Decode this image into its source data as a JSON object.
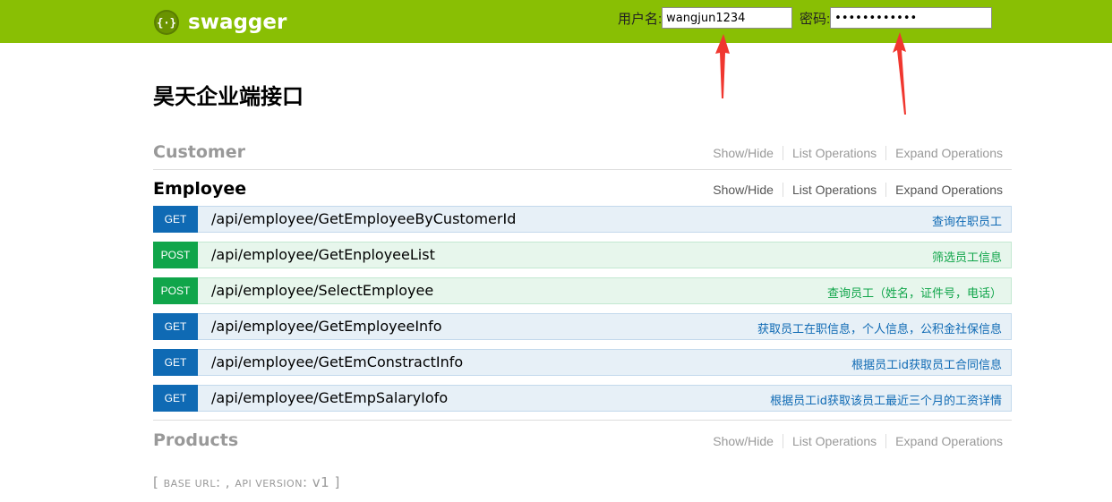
{
  "header": {
    "brand": "swagger",
    "username_label": "用户名:",
    "username_value": "wangjun1234",
    "password_label": "密码:",
    "password_value": "••••••••••••",
    "bg_color": "#89bf04"
  },
  "page_title": "昊天企业端接口",
  "resources": {
    "customer": {
      "name": "Customer",
      "show_hide": "Show/Hide",
      "list_ops": "List Operations",
      "expand_ops": "Expand Operations"
    },
    "employee": {
      "name": "Employee",
      "show_hide": "Show/Hide",
      "list_ops": "List Operations",
      "expand_ops": "Expand Operations"
    },
    "products": {
      "name": "Products",
      "show_hide": "Show/Hide",
      "list_ops": "List Operations",
      "expand_ops": "Expand Operations"
    }
  },
  "operations": [
    {
      "method": "GET",
      "path": "/api/employee/GetEmployeeByCustomerId",
      "summary": "查询在职员工"
    },
    {
      "method": "POST",
      "path": "/api/employee/GetEnployeeList",
      "summary": "筛选员工信息"
    },
    {
      "method": "POST",
      "path": "/api/employee/SelectEmployee",
      "summary": "查询员工（姓名，证件号，电话）"
    },
    {
      "method": "GET",
      "path": "/api/employee/GetEmployeeInfo",
      "summary": "获取员工在职信息，个人信息，公积金社保信息"
    },
    {
      "method": "GET",
      "path": "/api/employee/GetEmConstractInfo",
      "summary": "根据员工id获取员工合同信息"
    },
    {
      "method": "GET",
      "path": "/api/employee/GetEmpSalaryIofo",
      "summary": "根据员工id获取该员工最近三个月的工资详情"
    }
  ],
  "footer": {
    "open": "[ ",
    "base_url_label": "BASE URL",
    "sep1": ": , ",
    "api_version_label": "API VERSION",
    "sep2": ": ",
    "version": "v1",
    "close": " ]"
  },
  "colors": {
    "get": "#0f6ab4",
    "post": "#10a54a",
    "annotation_arrow": "#f0372f"
  }
}
